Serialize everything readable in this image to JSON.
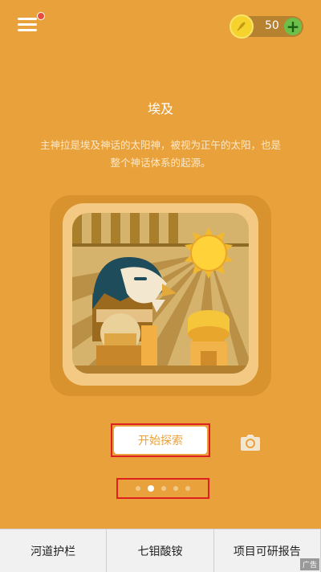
{
  "header": {
    "coins": "50",
    "coin_icon": "feather-coin-icon",
    "add_icon": "plus-icon"
  },
  "content": {
    "title": "埃及",
    "description": "主神拉是埃及神话的太阳神，被视为正午的太阳，也是整个神话体系的起源。"
  },
  "actions": {
    "explore_label": "开始探索"
  },
  "pager": {
    "total": 5,
    "active": 1
  },
  "bottom_nav": {
    "items": [
      {
        "label": "河道护栏"
      },
      {
        "label": "七钼酸铵"
      },
      {
        "label": "项目可研报告"
      }
    ],
    "ad_label": "广告"
  },
  "colors": {
    "background": "#E9A23B",
    "accent_add": "#6CC04A",
    "coin": "#F6D22D"
  }
}
